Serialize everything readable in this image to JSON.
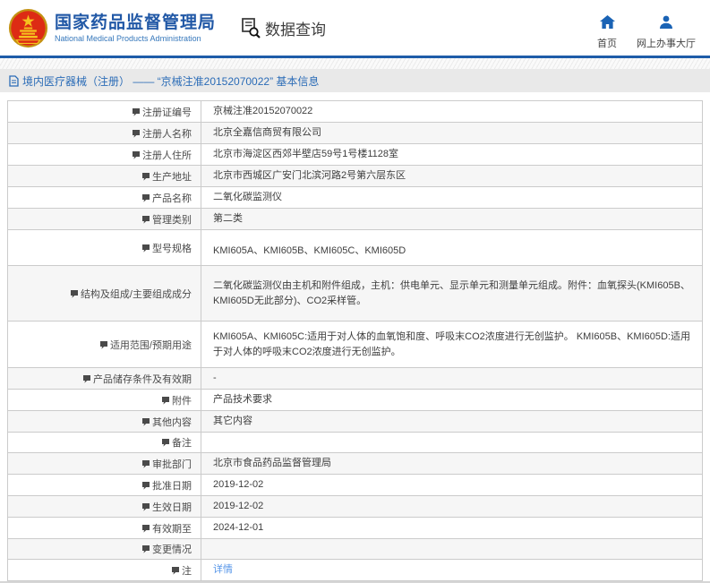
{
  "header": {
    "org_name_cn": "国家药品监督管理局",
    "org_name_en": "National Medical Products Administration",
    "query_tab_label": "数据查询",
    "nav": {
      "home_label": "首页",
      "hall_label": "网上办事大厅"
    }
  },
  "breadcrumb": {
    "text": "境内医疗器械（注册） ——  “京械注准20152070022”  基本信息"
  },
  "detail_table": {
    "rows": [
      {
        "label": "注册证编号",
        "value": "京械注准20152070022"
      },
      {
        "label": "注册人名称",
        "value": "北京全嘉信商贸有限公司"
      },
      {
        "label": "注册人住所",
        "value": "北京市海淀区西郊半壁店59号1号楼1128室"
      },
      {
        "label": "生产地址",
        "value": "北京市西城区广安门北滨河路2号第六层东区"
      },
      {
        "label": "产品名称",
        "value": "二氧化碳监测仪"
      },
      {
        "label": "管理类别",
        "value": "第二类"
      },
      {
        "label": "型号规格",
        "value": "KMI605A、KMI605B、KMI605C、KMI605D",
        "size": "tall"
      },
      {
        "label": "结构及组成/主要组成成分",
        "value": "二氧化碳监测仪由主机和附件组成，主机：供电单元、显示单元和测量单元组成。附件：血氧探头(KMI605B、KMI605D无此部分)、CO2采样管。",
        "size": "xl"
      },
      {
        "label": "适用范围/预期用途",
        "value": "KMI605A、KMI605C:适用于对人体的血氧饱和度、呼吸末CO2浓度进行无创监护。 KMI605B、KMI605D:适用于对人体的呼吸末CO2浓度进行无创监护。",
        "size": "lg"
      },
      {
        "label": "产品储存条件及有效期",
        "value": "-"
      },
      {
        "label": "附件",
        "value": "产品技术要求"
      },
      {
        "label": "其他内容",
        "value": "其它内容"
      },
      {
        "label": "备注",
        "value": ""
      },
      {
        "label": "审批部门",
        "value": "北京市食品药品监督管理局"
      },
      {
        "label": "批准日期",
        "value": "2019-12-02"
      },
      {
        "label": "生效日期",
        "value": "2019-12-02"
      },
      {
        "label": "有效期至",
        "value": "2024-12-01"
      },
      {
        "label": "变更情况",
        "value": ""
      },
      {
        "label": "注",
        "label_icon": "note-icon",
        "value": "详情",
        "value_type": "link"
      }
    ]
  },
  "colors": {
    "brand_blue": "#2158a6",
    "accent_blue": "#1e5ca8",
    "icon_blue": "#1a63b5",
    "breadcrumb_bg": "#e9e9e9",
    "breadcrumb_text": "#2b6cb7",
    "table_border": "#cbcbcb",
    "alt_row_bg": "#f6f6f6",
    "link_blue": "#5595e8",
    "emblem_red": "#dd2b14",
    "emblem_gold": "#f5c11e"
  }
}
